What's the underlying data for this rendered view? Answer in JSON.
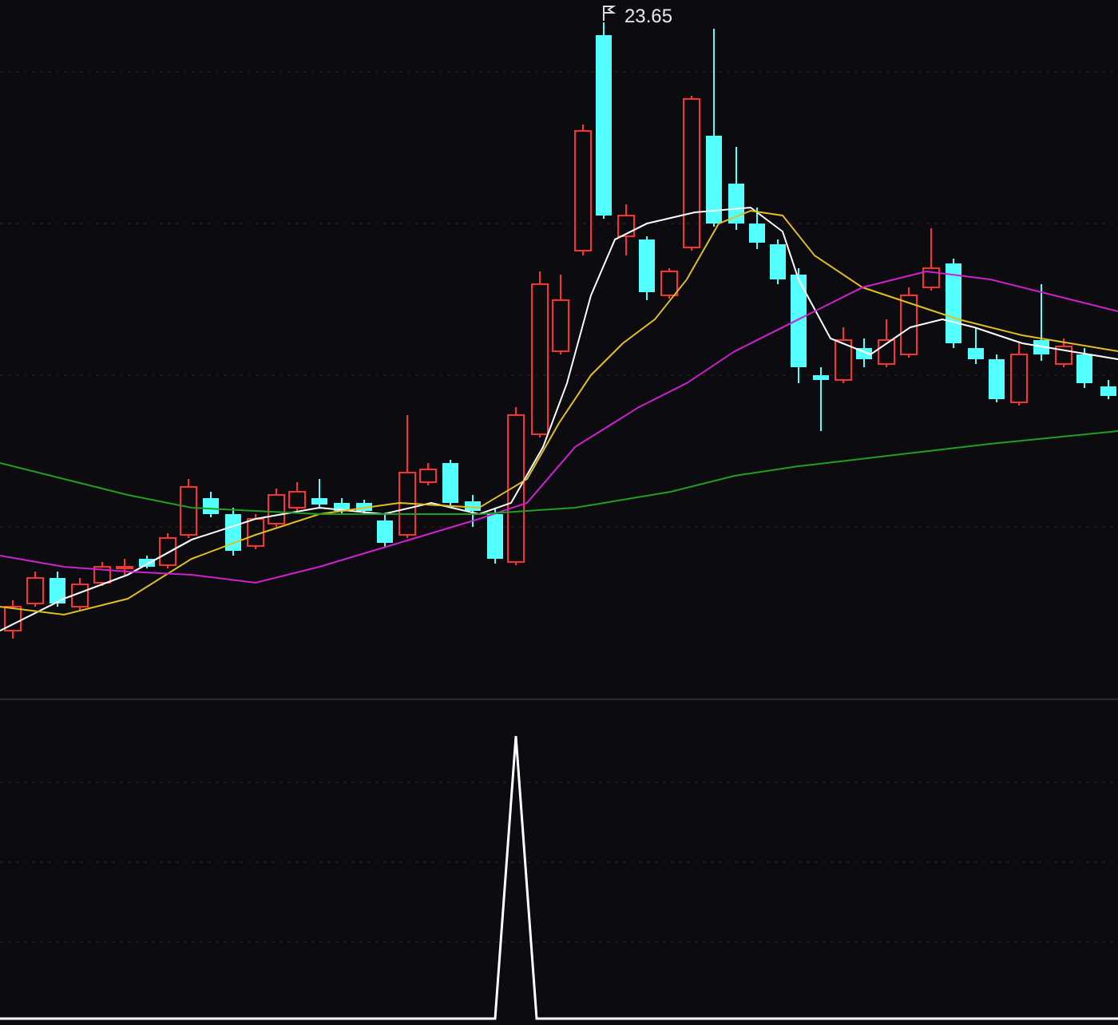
{
  "price_chart": {
    "high_label": "23.65"
  }
}
